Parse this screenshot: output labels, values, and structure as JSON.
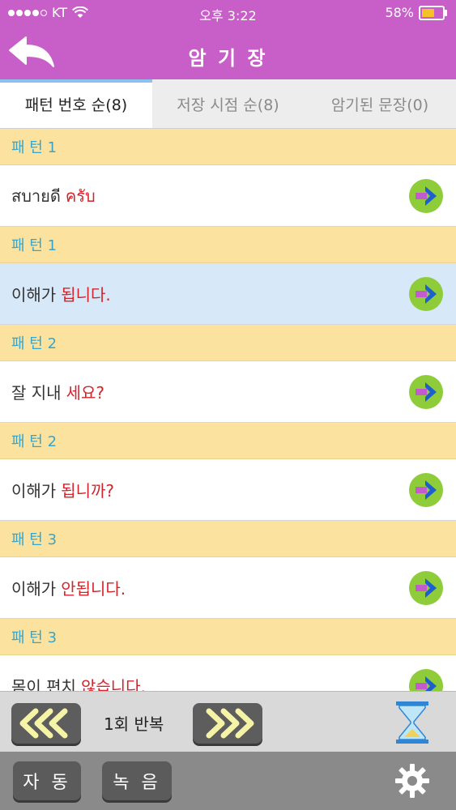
{
  "status_bar": {
    "carrier": "KT",
    "time": "오후 3:22",
    "battery_percent": "58%"
  },
  "nav": {
    "title": "암 기 장",
    "back_icon": "back-arrow-icon"
  },
  "tabs": [
    {
      "label": "패턴 번호 순(8)",
      "active": true
    },
    {
      "label": "저장 시점 순(8)",
      "active": false
    },
    {
      "label": "암기된 문장(0)",
      "active": false
    }
  ],
  "list": [
    {
      "header": "패 턴 1",
      "text": "สบายดี",
      "highlight": "ครับ",
      "selected": false
    },
    {
      "header": "패 턴 1",
      "text": "이해가",
      "highlight": "됩니다.",
      "selected": true
    },
    {
      "header": "패 턴 2",
      "text": "잘 지내",
      "highlight": "세요?",
      "selected": false
    },
    {
      "header": "패 턴 2",
      "text": "이해가",
      "highlight": "됩니까?",
      "selected": false
    },
    {
      "header": "패 턴 3",
      "text": "이해가",
      "highlight": "안됩니다.",
      "selected": false
    },
    {
      "header": "패 턴 3",
      "text": "몸이 편치",
      "highlight": "않습니다.",
      "selected": false
    }
  ],
  "controls": {
    "repeat_label": "1회 반복",
    "prev_icon": "rewind-icon",
    "next_icon": "fast-forward-icon",
    "timer_icon": "hourglass-icon"
  },
  "bottom": {
    "auto_label": "자 동",
    "record_label": "녹 음",
    "settings_icon": "gear-icon"
  },
  "colors": {
    "nav_bg": "#c85fc9",
    "header_row_bg": "#fbe39f",
    "header_row_text": "#3aa3c8",
    "highlight_text": "#d1242b",
    "selected_row_bg": "#d7e9f8",
    "go_button": "#8fcc3a"
  }
}
